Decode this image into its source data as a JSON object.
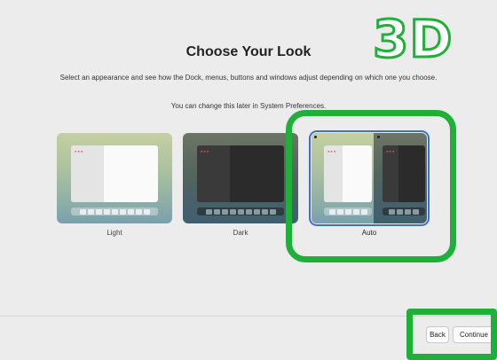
{
  "header": {
    "title": "Choose Your Look",
    "description": "Select an appearance and see how the Dock, menus, buttons and windows adjust depending on which one you choose.",
    "note": "You can change this later in System Preferences."
  },
  "options": [
    {
      "label": "Light",
      "selected": false
    },
    {
      "label": "Dark",
      "selected": false
    },
    {
      "label": "Auto",
      "selected": true
    }
  ],
  "footer": {
    "back_label": "Back",
    "continue_label": "Continue"
  },
  "overlay": {
    "logo_text": "3D",
    "highlight_color": "#1fb03a",
    "selection_color": "#3b6fd8"
  }
}
